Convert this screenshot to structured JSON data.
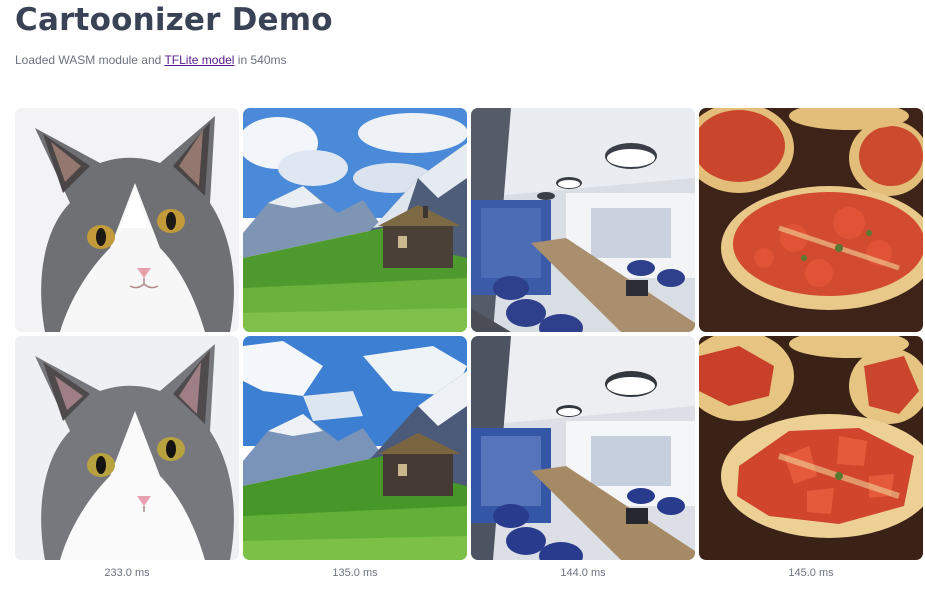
{
  "page": {
    "title": "Cartoonizer Demo",
    "subtitle_prefix": "Loaded WASM module and ",
    "subtitle_link": "TFLite model",
    "subtitle_suffix": " in 540ms",
    "link_color": "#551a8b"
  },
  "images": [
    {
      "subject": "cat",
      "timing": "233.0 ms"
    },
    {
      "subject": "mountain-cabin",
      "timing": "135.0 ms"
    },
    {
      "subject": "conference-room",
      "timing": "144.0 ms"
    },
    {
      "subject": "pizza",
      "timing": "145.0 ms"
    }
  ]
}
